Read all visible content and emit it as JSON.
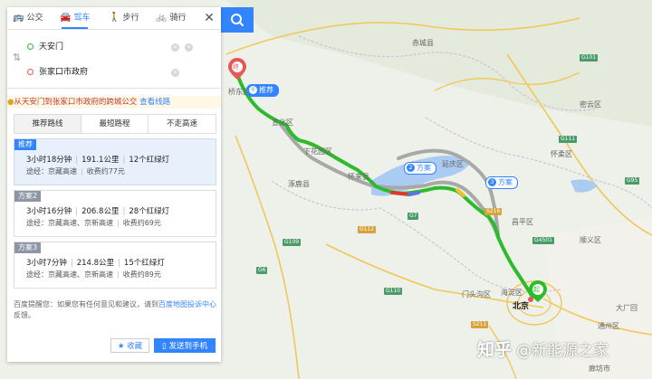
{
  "modes": [
    {
      "label": "公交",
      "icon": "bus-icon"
    },
    {
      "label": "驾车",
      "icon": "car-icon"
    },
    {
      "label": "步行",
      "icon": "walk-icon"
    },
    {
      "label": "骑行",
      "icon": "bike-icon"
    }
  ],
  "search": {
    "icon": "search-icon"
  },
  "route_inputs": {
    "origin": "天安门",
    "destination": "张家口市政府"
  },
  "notice": {
    "text": "从天安门到张家口市政府的跨城公交",
    "link": "查看线路"
  },
  "pref_tabs": [
    "推荐路线",
    "最短路程",
    "不走高速"
  ],
  "plans": [
    {
      "tag": "推荐",
      "time": "3小时18分钟",
      "distance": "191.1公里",
      "lights": "12个红绿灯",
      "via_label": "途经：",
      "via": "京藏高速",
      "toll": "收费约77元"
    },
    {
      "tag": "方案2",
      "time": "3小时16分钟",
      "distance": "206.8公里",
      "lights": "28个红绿灯",
      "via_label": "途经：",
      "via": "京藏高速、京新高速",
      "toll": "收费约69元"
    },
    {
      "tag": "方案3",
      "time": "3小时7分钟",
      "distance": "214.8公里",
      "lights": "15个红绿灯",
      "via_label": "途经：",
      "via": "京藏高速、京新高速",
      "toll": "收费约89元"
    }
  ],
  "tip": {
    "text": "百度提醒您：如果您有任何意见和建议，请到",
    "link": "百度地图投诉中心",
    "suffix": "反馈。"
  },
  "actions": {
    "favorite": "收藏",
    "send": "发送到手机"
  },
  "map": {
    "badges": [
      {
        "num": "①",
        "label": "推荐"
      },
      {
        "num": "2",
        "label": "方案"
      },
      {
        "num": "3",
        "label": "方案"
      }
    ],
    "start_marker": "起",
    "end_marker": "终",
    "city": "北京",
    "places": [
      "赤城县",
      "延庆区",
      "怀柔区",
      "怀来县",
      "门头沟区",
      "海淀区",
      "昌平区",
      "顺义区",
      "密云区",
      "大厂回",
      "通州区",
      "下花园区",
      "涿鹿县",
      "宣化区",
      "桥东区",
      "廊坊市"
    ],
    "roads": [
      "G6",
      "G7",
      "G95",
      "G109",
      "G110",
      "G111",
      "G112",
      "G4501",
      "S216",
      "G101",
      "S211"
    ],
    "colors": {
      "route_main": "#2bbb2b",
      "route_alt": "#a8a8a8",
      "accent": "#3385ff",
      "congestion": "#e0392b"
    }
  },
  "watermark": {
    "logo": "知乎",
    "text": "@新能源之家"
  }
}
